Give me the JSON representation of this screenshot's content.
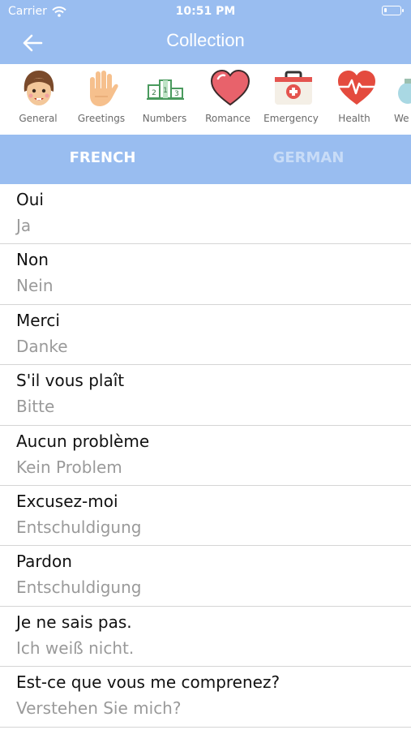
{
  "status": {
    "carrier": "Carrier",
    "time": "10:51 PM"
  },
  "nav": {
    "title": "Collection",
    "back_icon": "arrow-left-icon"
  },
  "categories": [
    {
      "label": "General",
      "icon": "face-icon"
    },
    {
      "label": "Greetings",
      "icon": "hand-icon"
    },
    {
      "label": "Numbers",
      "icon": "podium-icon"
    },
    {
      "label": "Romance",
      "icon": "heart-icon"
    },
    {
      "label": "Emergency",
      "icon": "first-aid-kit-icon"
    },
    {
      "label": "Health",
      "icon": "heartbeat-icon"
    },
    {
      "label": "We",
      "icon": "partial-icon"
    }
  ],
  "tabs": [
    {
      "label": "FRENCH",
      "active": true
    },
    {
      "label": "GERMAN",
      "active": false
    }
  ],
  "phrases": [
    {
      "source": "Oui",
      "translation": "Ja"
    },
    {
      "source": "Non",
      "translation": "Nein"
    },
    {
      "source": "Merci",
      "translation": "Danke"
    },
    {
      "source": "S'il vous plaît",
      "translation": "Bitte"
    },
    {
      "source": "Aucun problème",
      "translation": "Kein Problem"
    },
    {
      "source": "Excusez-moi",
      "translation": "Entschuldigung"
    },
    {
      "source": "Pardon",
      "translation": "Entschuldigung"
    },
    {
      "source": "Je ne sais pas.",
      "translation": "Ich weiß nicht."
    },
    {
      "source": "Est-ce que vous me comprenez?",
      "translation": "Verstehen Sie mich?"
    }
  ],
  "colors": {
    "accent": "#99bdf0",
    "inactive_tab": "#c8dcf7"
  }
}
